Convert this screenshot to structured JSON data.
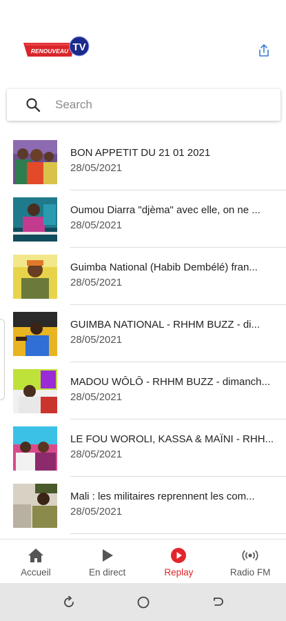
{
  "header": {
    "logo_text": "RENOUVEAU",
    "logo_badge": "TV",
    "share_icon": "share-icon"
  },
  "search": {
    "placeholder": "Search",
    "value": ""
  },
  "items": [
    {
      "title": "BON APPETIT DU 21 01 2021",
      "date": "28/05/2021"
    },
    {
      "title": "Oumou Diarra \"djèma\" avec elle, on ne ...",
      "date": "28/05/2021"
    },
    {
      "title": "Guimba National (Habib Dembélé) fran...",
      "date": "28/05/2021"
    },
    {
      "title": "GUIMBA NATIONAL - RHHM BUZZ - di...",
      "date": "28/05/2021"
    },
    {
      "title": "MADOU WÔLÔ - RHHM BUZZ - dimanch...",
      "date": "28/05/2021"
    },
    {
      "title": "LE FOU WOROLI, KASSA & MAÏNI - RHH...",
      "date": "28/05/2021"
    },
    {
      "title": "Mali : les militaires reprennent les com...",
      "date": "28/05/2021"
    }
  ],
  "tabs": [
    {
      "label": "Accueil",
      "icon": "home-icon",
      "active": false
    },
    {
      "label": "En direct",
      "icon": "play-icon",
      "active": false
    },
    {
      "label": "Replay",
      "icon": "replay-icon",
      "active": true
    },
    {
      "label": "Radio FM",
      "icon": "radio-icon",
      "active": false
    }
  ],
  "colors": {
    "accent": "#e3242b",
    "logo_blue": "#1c2a8a"
  }
}
